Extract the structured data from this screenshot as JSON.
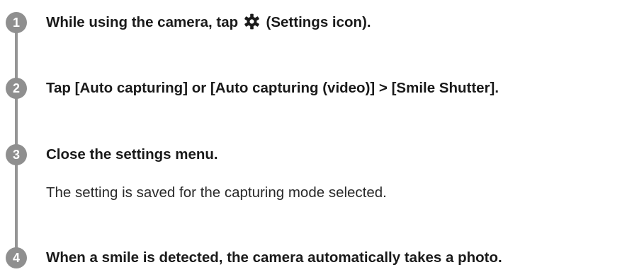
{
  "steps": [
    {
      "number": "1",
      "title_before": "While using the camera, tap",
      "icon": "gear-icon",
      "title_after": "(Settings icon)."
    },
    {
      "number": "2",
      "title": "Tap [Auto capturing] or [Auto capturing (video)] > [Smile Shutter]."
    },
    {
      "number": "3",
      "title": "Close the settings menu.",
      "description": "The setting is saved for the capturing mode selected."
    },
    {
      "number": "4",
      "title": "When a smile is detected, the camera automatically takes a photo."
    }
  ],
  "colors": {
    "badge": "#8f8f8f",
    "rail": "#959595",
    "text": "#1a1a1a"
  }
}
